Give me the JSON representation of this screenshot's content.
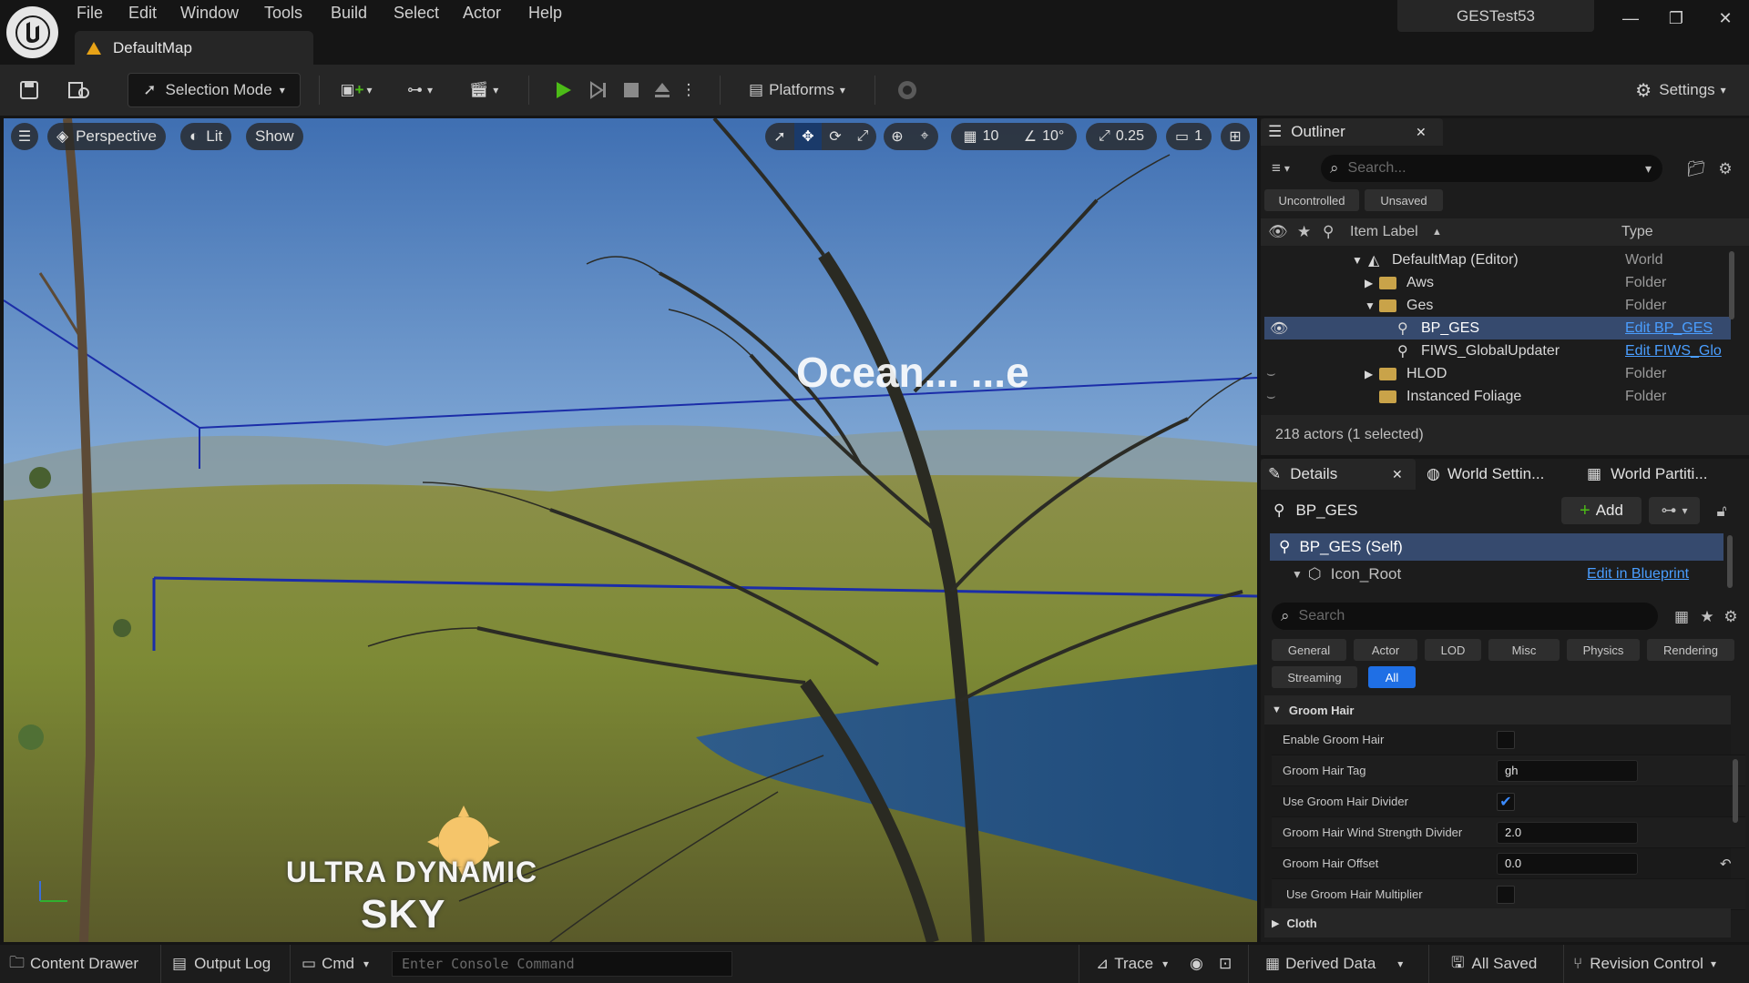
{
  "menu": [
    "File",
    "Edit",
    "Window",
    "Tools",
    "Build",
    "Select",
    "Actor",
    "Help"
  ],
  "project_name": "GESTest53",
  "tab_title": "DefaultMap",
  "toolbar": {
    "selection_mode": "Selection Mode",
    "platforms": "Platforms",
    "settings": "Settings"
  },
  "viewport": {
    "perspective": "Perspective",
    "lit": "Lit",
    "show": "Show",
    "grid_size": "10",
    "rotation_snap": "10°",
    "scale_snap": "0.25",
    "camera_speed": "1",
    "overlay_text_ocean": "Ocean... ...e",
    "logo_line1": "ULTRA DYNAMIC",
    "logo_line2": "SKY"
  },
  "outliner": {
    "title": "Outliner",
    "search_placeholder": "Search...",
    "filters": [
      "Uncontrolled",
      "Unsaved"
    ],
    "col_label": "Item Label",
    "col_type": "Type",
    "rows": [
      {
        "label": "DefaultMap (Editor)",
        "type": "World",
        "icon": "world-icon"
      },
      {
        "label": "Aws",
        "type": "Folder",
        "icon": "folder-icon"
      },
      {
        "label": "Ges",
        "type": "Folder",
        "icon": "folder-icon"
      },
      {
        "label": "BP_GES",
        "type": "Edit BP_GES",
        "icon": "actor-icon",
        "selected": true
      },
      {
        "label": "FIWS_GlobalUpdater",
        "type": "Edit FIWS_Glo",
        "icon": "actor-icon"
      },
      {
        "label": "HLOD",
        "type": "Folder",
        "icon": "folder-icon"
      },
      {
        "label": "Instanced Foliage",
        "type": "Folder",
        "icon": "folder-icon"
      }
    ],
    "status": "218 actors (1 selected)"
  },
  "details": {
    "tabs": [
      "Details",
      "World Settin...",
      "World Partiti..."
    ],
    "actor_name": "BP_GES",
    "add_label": "Add",
    "components": [
      {
        "label": "BP_GES (Self)"
      },
      {
        "label": "Icon_Root",
        "link": "Edit in Blueprint"
      }
    ],
    "search_placeholder": "Search",
    "categories": [
      "General",
      "Actor",
      "LOD",
      "Misc",
      "Physics",
      "Rendering",
      "Streaming",
      "All"
    ],
    "section": "Groom Hair",
    "props": [
      {
        "label": "Enable Groom Hair",
        "kind": "checkbox",
        "checked": false
      },
      {
        "label": "Groom Hair Tag",
        "kind": "text",
        "value": "gh"
      },
      {
        "label": "Use Groom Hair Divider",
        "kind": "checkbox",
        "checked": true
      },
      {
        "label": "Groom Hair Wind Strength Divider",
        "kind": "text",
        "value": "2.0"
      },
      {
        "label": "Groom Hair Offset",
        "kind": "text",
        "value": "0.0"
      },
      {
        "label": "Use Groom Hair Multiplier",
        "kind": "checkbox",
        "checked": false
      }
    ],
    "section2": "Cloth"
  },
  "bottombar": {
    "content_drawer": "Content Drawer",
    "output_log": "Output Log",
    "cmd": "Cmd",
    "console_placeholder": "Enter Console Command",
    "trace": "Trace",
    "derived_data": "Derived Data",
    "all_saved": "All Saved",
    "revision_control": "Revision Control"
  },
  "colors": {
    "accent": "#3b8bff",
    "play": "#4cbb17",
    "folder": "#c9a349",
    "link": "#4a9eff"
  }
}
